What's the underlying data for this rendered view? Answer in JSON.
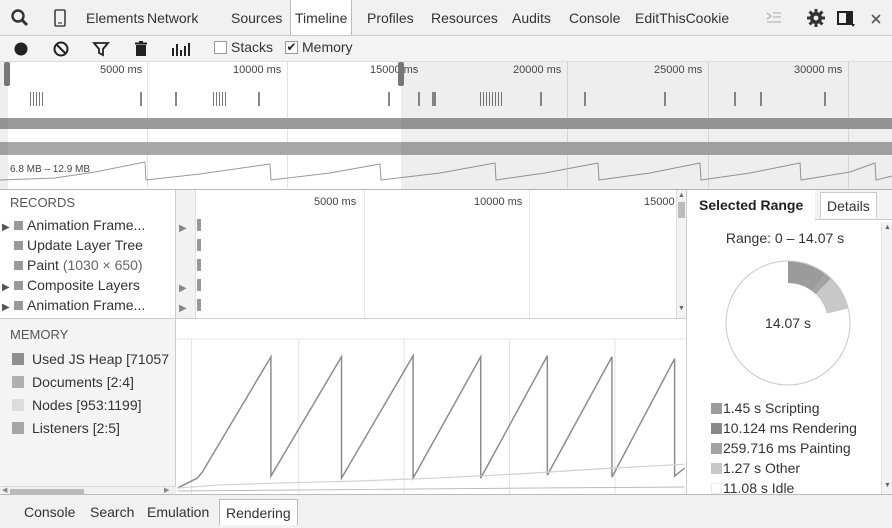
{
  "tabs": [
    {
      "label": "Elements",
      "active": false
    },
    {
      "label": "Network",
      "active": false
    },
    {
      "label": "Sources",
      "active": false
    },
    {
      "label": "Timeline",
      "active": true
    },
    {
      "label": "Profiles",
      "active": false
    },
    {
      "label": "Resources",
      "active": false
    },
    {
      "label": "Audits",
      "active": false
    },
    {
      "label": "Console",
      "active": false
    },
    {
      "label": "EditThisCookie",
      "active": false
    }
  ],
  "tab_icons": [
    "search-icon",
    "device-mode-icon",
    "show-console-icon",
    "gear-icon",
    "dock-icon",
    "close-icon"
  ],
  "toolbar": {
    "icons": [
      "record-icon",
      "clear-icon",
      "filter-icon",
      "trash-icon",
      "flame-chart-icon"
    ],
    "stacks_label": "Stacks",
    "stacks_checked": false,
    "memory_label": "Memory",
    "memory_checked": true
  },
  "overview": {
    "ticks": [
      "5000 ms",
      "10000 ms",
      "15000 ms",
      "20000 ms",
      "25000 ms",
      "30000 ms"
    ],
    "memory_range": "6.8 MB – 12.9 MB"
  },
  "records": {
    "header": "RECORDS",
    "rows": [
      {
        "label": "Animation Frame...",
        "detail": "",
        "expandable": true
      },
      {
        "label": "Update Layer Tree",
        "detail": "",
        "expandable": false
      },
      {
        "label": "Paint",
        "detail": "(1030 × 650)",
        "expandable": false
      },
      {
        "label": "Composite Layers",
        "detail": "",
        "expandable": true
      },
      {
        "label": "Animation Frame...",
        "detail": "",
        "expandable": true
      }
    ],
    "timeline_ticks": [
      "5000 ms",
      "10000 ms",
      "15000"
    ]
  },
  "memory": {
    "header": "MEMORY",
    "counters": [
      {
        "label": "Used JS Heap [71057",
        "color": "#8f8f8f"
      },
      {
        "label": "Documents [2:4]",
        "color": "#b0b0b0"
      },
      {
        "label": "Nodes [953:1199]",
        "color": "#dcdcdc"
      },
      {
        "label": "Listeners [2:5]",
        "color": "#a6a6a6"
      }
    ]
  },
  "summary": {
    "tabs": {
      "selected": "Selected Range",
      "other": "Details"
    },
    "range_text": "Range: 0 – 14.07 s",
    "pie_total": "14.07 s",
    "items": [
      {
        "label": "1.45 s Scripting",
        "color": "#9b9b9b",
        "seconds": 1.45
      },
      {
        "label": "10.124 ms Rendering",
        "color": "#888888",
        "seconds": 0.010124
      },
      {
        "label": "259.716 ms Painting",
        "color": "#a3a3a3",
        "seconds": 0.259716
      },
      {
        "label": "1.27 s Other",
        "color": "#c8c8c8",
        "seconds": 1.27
      },
      {
        "label": "11.08 s Idle",
        "color": "#ffffff",
        "seconds": 11.08
      }
    ]
  },
  "drawer": {
    "tabs": [
      {
        "label": "Console",
        "active": false
      },
      {
        "label": "Search",
        "active": false
      },
      {
        "label": "Emulation",
        "active": false
      },
      {
        "label": "Rendering",
        "active": true
      }
    ]
  }
}
